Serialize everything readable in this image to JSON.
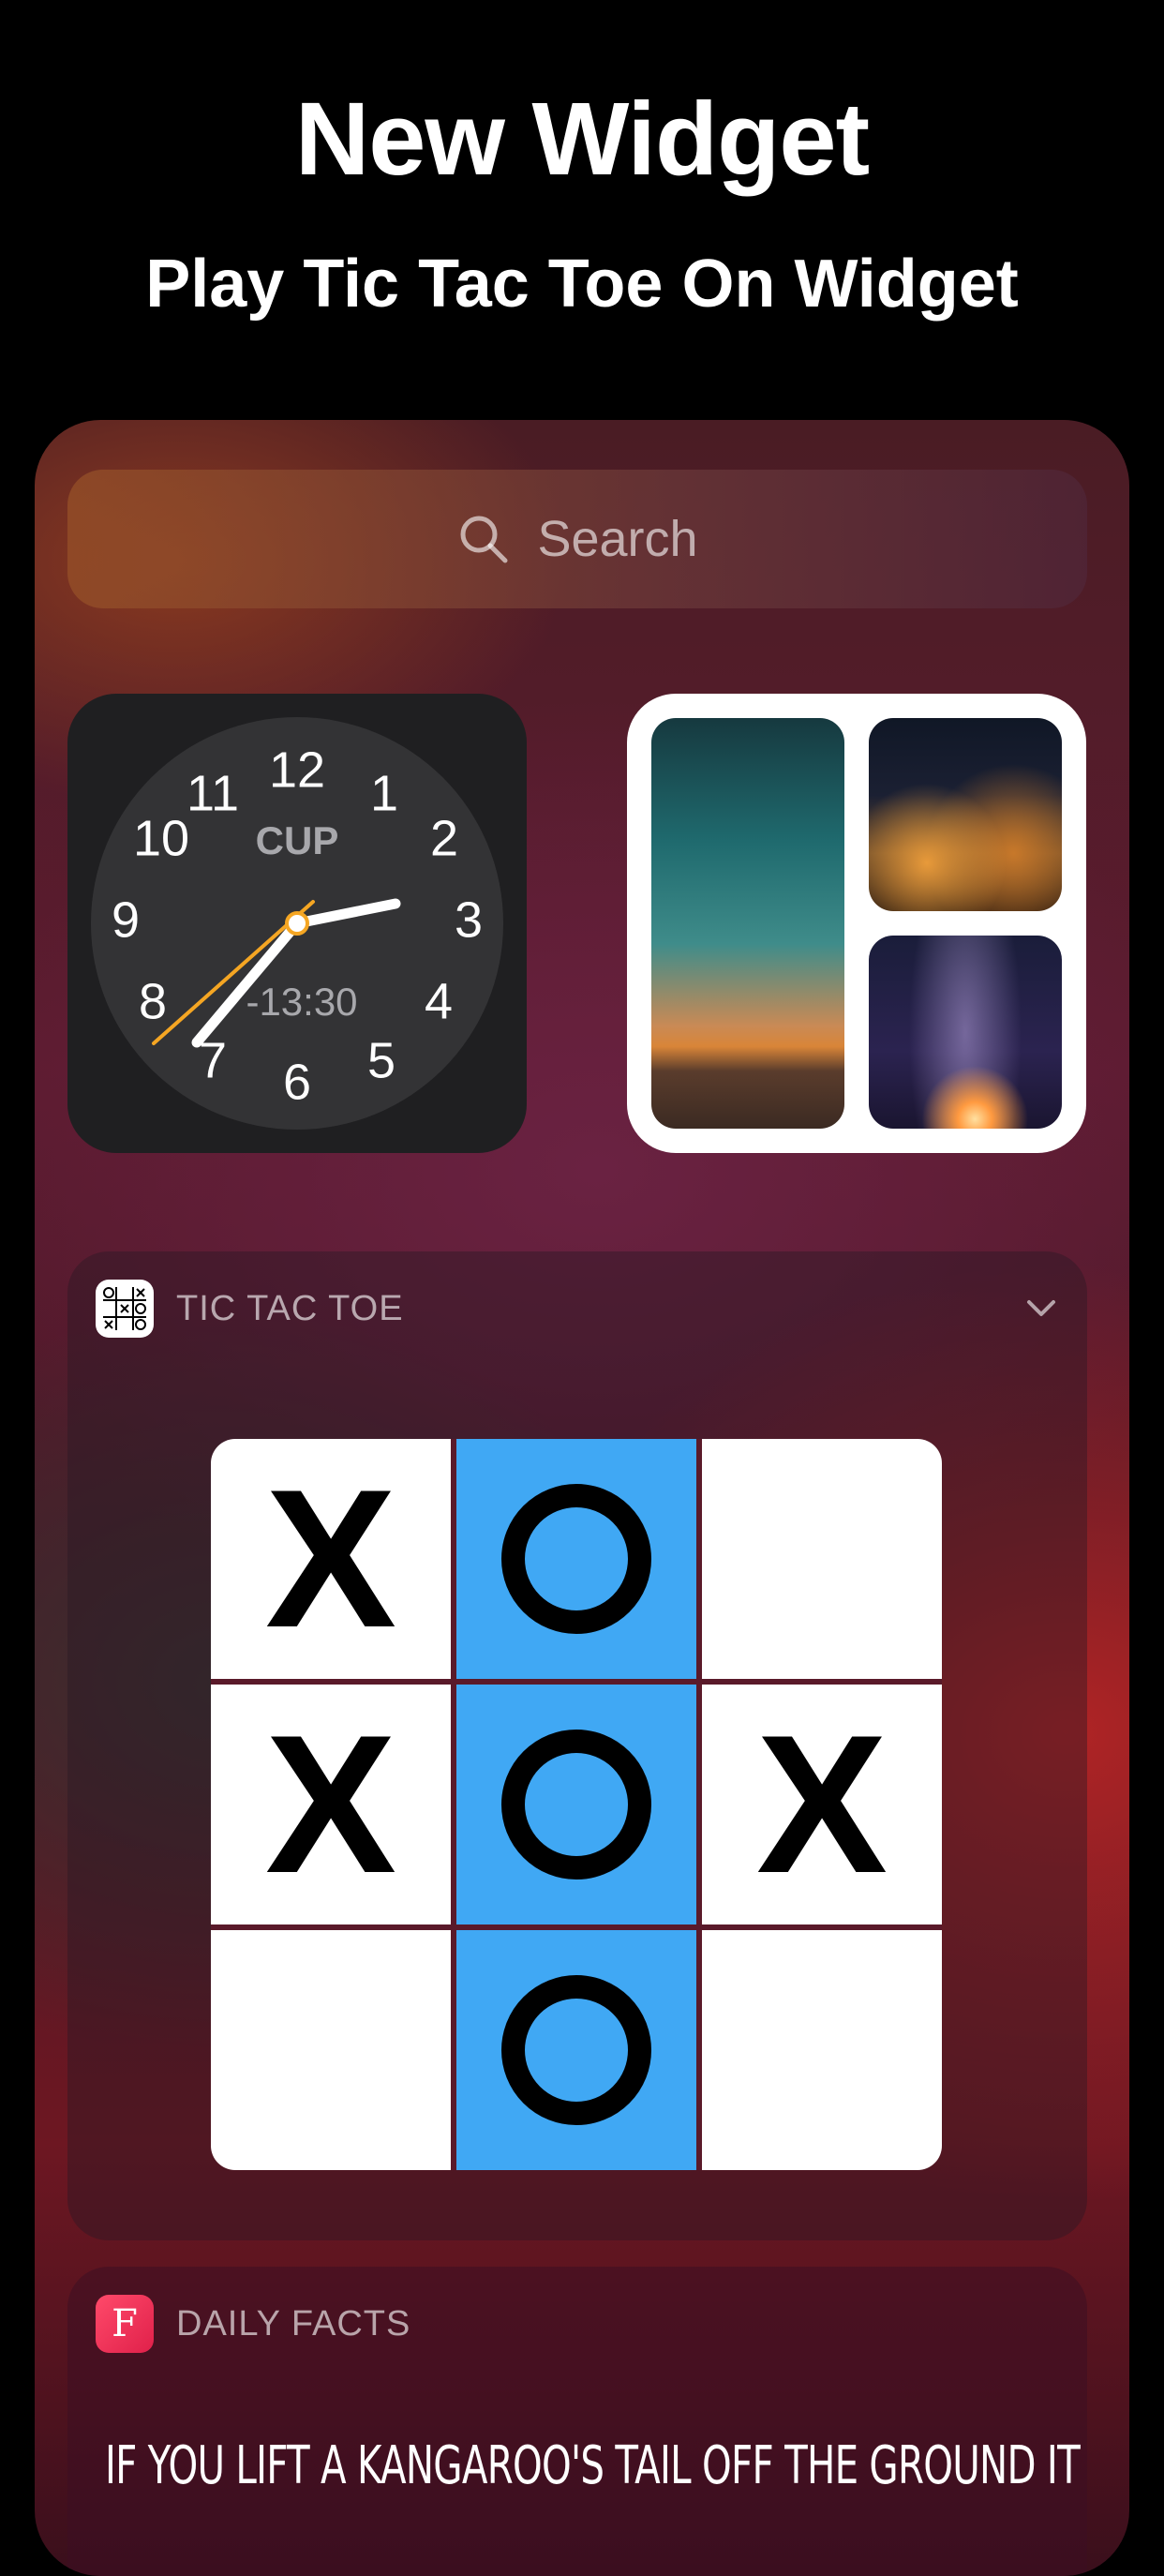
{
  "header": {
    "title": "New Widget",
    "subtitle": "Play  Tic Tac Toe On Widget"
  },
  "search": {
    "placeholder": "Search"
  },
  "clock": {
    "numerals": [
      "12",
      "1",
      "2",
      "3",
      "4",
      "5",
      "6",
      "7",
      "8",
      "9",
      "10",
      "11"
    ],
    "city": "CUP",
    "time": "-13:30"
  },
  "tic_tac_toe": {
    "app_name": "TIC TAC TOE",
    "board": [
      [
        "X",
        "O",
        ""
      ],
      [
        "X",
        "O",
        "X"
      ],
      [
        "",
        "O",
        ""
      ]
    ],
    "highlight_color": "#40a8f4"
  },
  "daily_facts": {
    "app_name": "DAILY FACTS",
    "icon_letter": "F",
    "fact": "IF YOU LIFT A KANGAROO'S TAIL OFF THE GROUND IT"
  }
}
